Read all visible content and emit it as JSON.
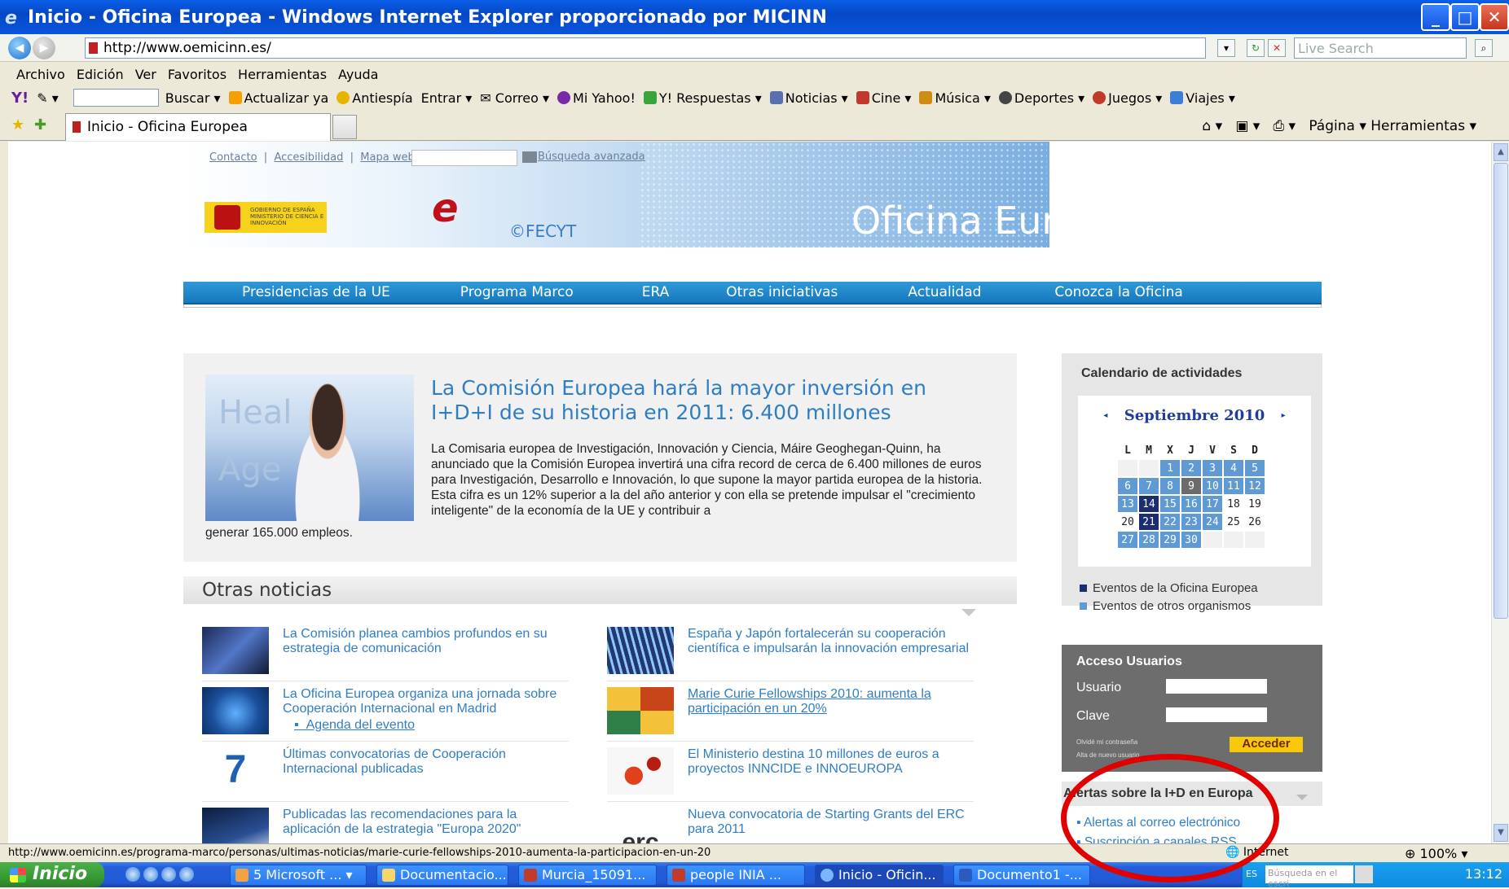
{
  "window": {
    "title": "Inicio - Oficina Europea - Windows Internet Explorer proporcionado por MICINN",
    "min_glyph": "_",
    "max_glyph": "□",
    "close_glyph": "✕"
  },
  "address_bar": {
    "url": "http://www.oemicinn.es/",
    "search_placeholder": "Live Search"
  },
  "menu": [
    "Archivo",
    "Edición",
    "Ver",
    "Favoritos",
    "Herramientas",
    "Ayuda"
  ],
  "yahoo_toolbar": {
    "logo": "Y!",
    "items": [
      "Buscar",
      "Actualizar ya",
      "Antiespía",
      "Entrar",
      "Correo",
      "Mi Yahoo!",
      "Y! Respuestas",
      "Noticias",
      "Cine",
      "Música",
      "Deportes",
      "Juegos",
      "Viajes"
    ]
  },
  "tabs": {
    "active_tab": "Inicio - Oficina Europea",
    "tools": "Página ▾   Herramientas ▾"
  },
  "page": {
    "top_links": [
      "Contacto",
      "Accesibilidad",
      "Mapa web"
    ],
    "advanced_search": "Búsqueda avanzada",
    "gobierno_text": "GOBIERNO DE ESPAÑA   MINISTERIO DE CIENCIA E INNOVACIÓN",
    "fecyt": "©FECYT",
    "banner_title": "Oficina Europea",
    "nav": [
      "Presidencias de la UE",
      "Programa Marco",
      "ERA",
      "Otras iniciativas",
      "Actualidad",
      "Conozca la Oficina"
    ],
    "featured": {
      "image_words": "Heal\nAge",
      "title": "La Comisión Europea hará la mayor inversión en I+D+I de su historia en 2011: 6.400 millones",
      "text": "La Comisaria europea de Investigación, Innovación y Ciencia, Máire Geoghegan-Quinn, ha anunciado que la Comisión Europea invertirá una cifra record de cerca de 6.400 millones de euros para Investigación, Desarrollo e Innovación, lo que supone la mayor partida europea de la historia. Esta cifra es un 12% superior a la del año anterior y con ella se pretende impulsar el \"crecimiento inteligente\" de la economía de la UE y contribuir a",
      "text_end": "generar 165.000 empleos."
    },
    "otras_noticias": {
      "heading": "Otras noticias",
      "left": [
        {
          "text": "La Comisión planea cambios profundos en su estrategia de comunicación"
        },
        {
          "text": "La Oficina Europea organiza una jornada sobre Cooperación Internacional en Madrid",
          "sub": "Agenda del evento"
        },
        {
          "text": "Últimas convocatorias de Cooperación Internacional publicadas"
        },
        {
          "text": "Publicadas las recomendaciones para la aplicación de la estrategia \"Europa 2020\""
        }
      ],
      "right": [
        {
          "text": "España y Japón fortalecerán su cooperación científica e impulsarán la innovación empresarial"
        },
        {
          "text": "Marie Curie Fellowships 2010: aumenta la participación en un 20%"
        },
        {
          "text": "El Ministerio destina 10 millones de euros a proyectos INNCIDE e INNOEUROPA"
        },
        {
          "text": "Nueva convocatoria de Starting Grants del ERC para 2011"
        }
      ]
    },
    "calendar": {
      "heading": "Calendario de actividades",
      "month": "Septiembre 2010",
      "prev": "◂",
      "next": "▸",
      "weekdays": [
        "L",
        "M",
        "X",
        "J",
        "V",
        "S",
        "D"
      ],
      "cells": [
        {
          "d": "",
          "k": "e"
        },
        {
          "d": "",
          "k": "e"
        },
        {
          "d": "1",
          "k": "o"
        },
        {
          "d": "2",
          "k": "o"
        },
        {
          "d": "3",
          "k": "o"
        },
        {
          "d": "4",
          "k": "o"
        },
        {
          "d": "5",
          "k": "o"
        },
        {
          "d": "6",
          "k": "o"
        },
        {
          "d": "7",
          "k": "o"
        },
        {
          "d": "8",
          "k": "o"
        },
        {
          "d": "9",
          "k": "g"
        },
        {
          "d": "10",
          "k": "o"
        },
        {
          "d": "11",
          "k": "o"
        },
        {
          "d": "12",
          "k": "o"
        },
        {
          "d": "13",
          "k": "o"
        },
        {
          "d": "14",
          "k": "n"
        },
        {
          "d": "15",
          "k": "o"
        },
        {
          "d": "16",
          "k": "o"
        },
        {
          "d": "17",
          "k": "o"
        },
        {
          "d": "18",
          "k": "w"
        },
        {
          "d": "19",
          "k": "w"
        },
        {
          "d": "20",
          "k": "w"
        },
        {
          "d": "21",
          "k": "n"
        },
        {
          "d": "22",
          "k": "o"
        },
        {
          "d": "23",
          "k": "o"
        },
        {
          "d": "24",
          "k": "o"
        },
        {
          "d": "25",
          "k": "w"
        },
        {
          "d": "26",
          "k": "w"
        },
        {
          "d": "27",
          "k": "o"
        },
        {
          "d": "28",
          "k": "o"
        },
        {
          "d": "29",
          "k": "o"
        },
        {
          "d": "30",
          "k": "o"
        },
        {
          "d": "",
          "k": "e"
        },
        {
          "d": "",
          "k": "e"
        },
        {
          "d": "",
          "k": "e"
        }
      ],
      "legend": [
        "Eventos de la Oficina Europea",
        "Eventos de otros organismos"
      ]
    },
    "acceso": {
      "heading": "Acceso Usuarios",
      "usuario": "Usuario",
      "clave": "Clave",
      "olvide": "Olvidé mi contraseña",
      "alta": "Alta de nuevo usuario",
      "button": "Acceder"
    },
    "alertas": {
      "heading": "Alertas sobre la I+D en Europa",
      "items": [
        "Alertas al correo electrónico",
        "Suscripción a canales RSS"
      ]
    }
  },
  "status_bar": {
    "url": "http://www.oemicinn.es/programa-marco/personas/ultimas-noticias/marie-curie-fellowships-2010-aumenta-la-participacion-en-un-20",
    "zone": "Internet",
    "zoom": "100%"
  },
  "taskbar": {
    "start": "Inicio",
    "tasks": [
      "5 Microsoft ...",
      "Documentacio...",
      "Murcia_15091...",
      "people INIA ...",
      "Inicio - Oficin...",
      "Documento1 -..."
    ],
    "lang": "ES",
    "search_placeholder": "Búsqueda en el escri",
    "clock": "13:12"
  },
  "colors": {
    "link_blue": "#2f7ec4",
    "nav_blue": "#1677be",
    "accent_yellow": "#f7c90a",
    "annotation_red": "#e10000"
  }
}
